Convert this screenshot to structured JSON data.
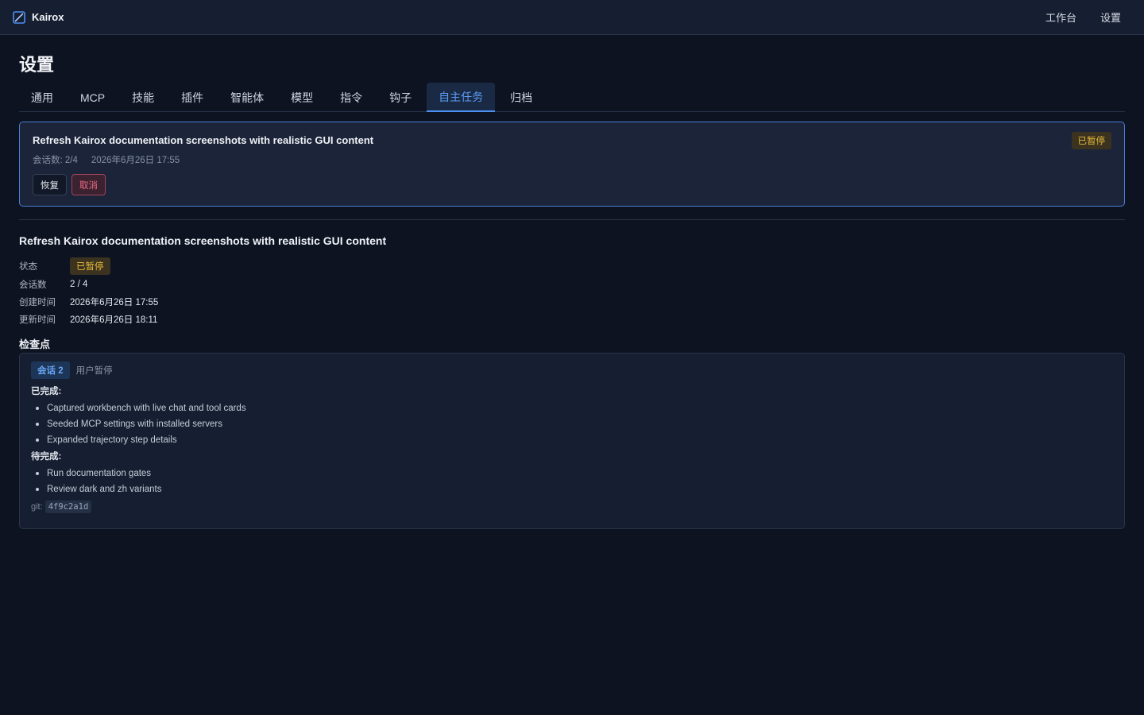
{
  "app": {
    "name": "Kairox",
    "nav": [
      "工作台",
      "设置"
    ]
  },
  "page": {
    "title": "设置",
    "tabs": [
      "通用",
      "MCP",
      "技能",
      "插件",
      "智能体",
      "模型",
      "指令",
      "钩子",
      "自主任务",
      "归档"
    ],
    "active_tab": "自主任务"
  },
  "task_card": {
    "title": "Refresh Kairox documentation screenshots with realistic GUI content",
    "status": "已暂停",
    "sessions": "会话数: 2/4",
    "created": "2026年6月26日 17:55",
    "resume_label": "恢复",
    "cancel_label": "取消"
  },
  "detail": {
    "title": "Refresh Kairox documentation screenshots with realistic GUI content",
    "rows": [
      {
        "key": "状态",
        "value": "已暂停"
      },
      {
        "key": "会话数",
        "value": "2 / 4"
      },
      {
        "key": "创建时间",
        "value": "2026年6月26日 17:55"
      },
      {
        "key": "更新时间",
        "value": "2026年6月26日 18:11"
      }
    ]
  },
  "checkpoint": {
    "section_label": "检查点",
    "session_tag": "会话 2",
    "reason": "用户暂停",
    "completed_label": "已完成:",
    "completed": [
      "Captured workbench with live chat and tool cards",
      "Seeded MCP settings with installed servers",
      "Expanded trajectory step details"
    ],
    "pending_label": "待完成:",
    "pending": [
      "Run documentation gates",
      "Review dark and zh variants"
    ],
    "git_label": "git:",
    "git_hash": "4f9c2a1d"
  },
  "colors": {
    "background": "#0d1321",
    "accent": "#4d8ff0",
    "paused": "#e5b93a",
    "danger": "#f06a85"
  }
}
